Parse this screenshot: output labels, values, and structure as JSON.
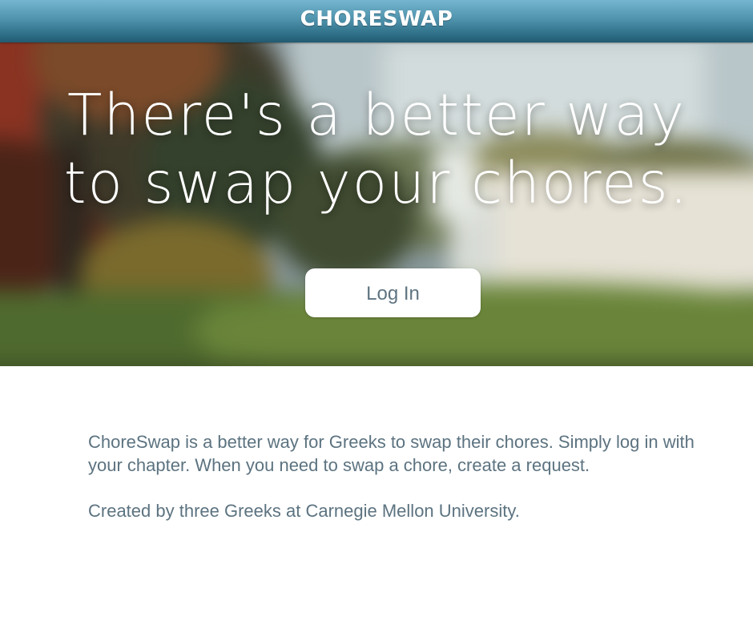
{
  "header": {
    "logo_text": "CHORESWAP"
  },
  "hero": {
    "title_line1": "There's a better way",
    "title_line2": "to swap your chores.",
    "login_label": "Log In"
  },
  "about": {
    "paragraph1": "ChoreSwap is a better way for Greeks to swap their chores. Simply log in with your chapter. When you need to swap a chore, create a request.",
    "paragraph2": "Created by three Greeks at Carnegie Mellon University."
  },
  "colors": {
    "header_gradient_top": "#75b5cf",
    "header_gradient_bottom": "#225a70",
    "body_text": "#5c7380",
    "button_text": "#5f7481"
  }
}
